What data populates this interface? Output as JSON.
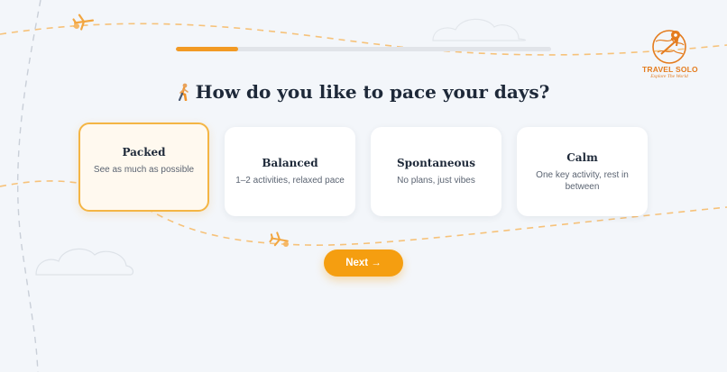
{
  "progress": {
    "fraction": 0.165
  },
  "logo": {
    "title": "TRAVEL SOLO",
    "subtitle": "Explore The World"
  },
  "question": {
    "text": "How do you like to pace your days?",
    "icon": "walking-person-icon"
  },
  "options": [
    {
      "title": "Packed",
      "description": "See as much as possible",
      "selected": true
    },
    {
      "title": "Balanced",
      "description": "1–2 activities, relaxed pace",
      "selected": false
    },
    {
      "title": "Spontaneous",
      "description": "No plans, just vibes",
      "selected": false
    },
    {
      "title": "Calm",
      "description": "One key activity, rest in between",
      "selected": false
    }
  ],
  "next_button": {
    "label": "Next →"
  },
  "colors": {
    "accent": "#f59e10",
    "selected_border": "#f4b544",
    "text": "#1e2939"
  }
}
